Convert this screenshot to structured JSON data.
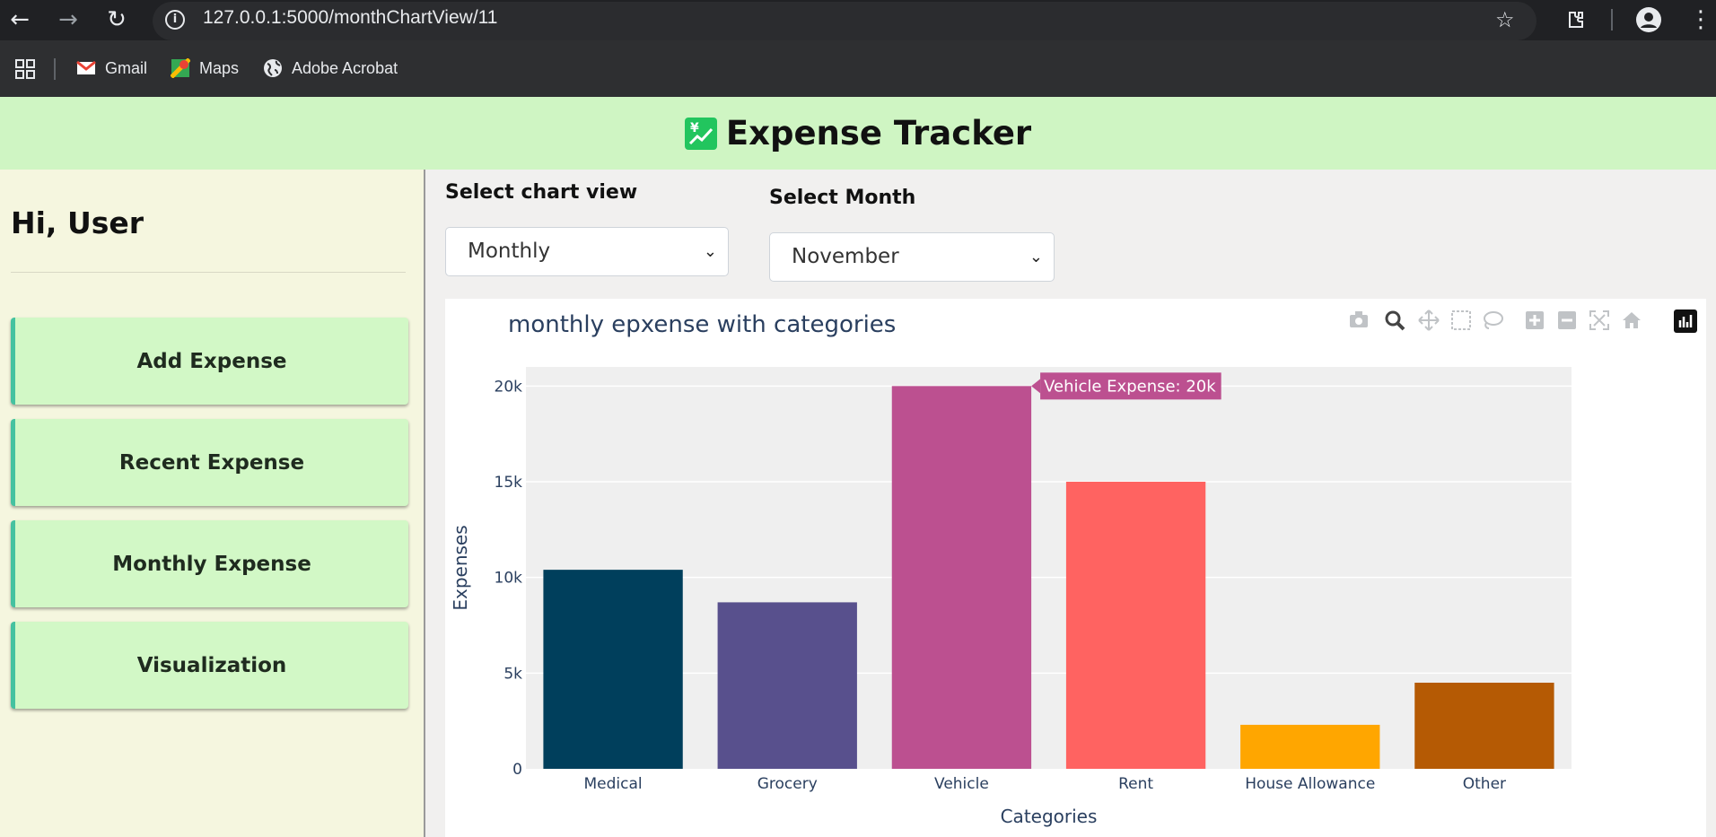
{
  "browser": {
    "url": "127.0.0.1:5000/monthChartView/11",
    "bookmarks": [
      "Gmail",
      "Maps",
      "Adobe Acrobat"
    ],
    "icons": [
      "back-arrow-icon",
      "forward-arrow-icon",
      "reload-icon",
      "info-icon",
      "star-icon",
      "extensions-icon",
      "profile-icon",
      "menu-dots-icon",
      "apps-grid-icon"
    ]
  },
  "app": {
    "title": "Expense Tracker",
    "greeting": "Hi, User",
    "nav": [
      "Add Expense",
      "Recent Expense",
      "Monthly Expense",
      "Visualization"
    ]
  },
  "controls": {
    "chart_view_label": "Select chart view",
    "chart_view_value": "Monthly",
    "month_label": "Select Month",
    "month_value": "November"
  },
  "tooltip": "Vehicle Expense: 20k",
  "colors": {
    "header_bg": "#cff5c3",
    "sidebar_bg": "#f5f6df",
    "button_bg": "#d2f8c6",
    "button_accent": "#45c2a0"
  },
  "chart_data": {
    "type": "bar",
    "title": "monthly epxense with categories",
    "xlabel": "Categories",
    "ylabel": "Expenses",
    "categories": [
      "Medical",
      "Grocery",
      "Vehicle",
      "Rent",
      "House Allowance",
      "Other"
    ],
    "values": [
      10400,
      8700,
      20000,
      15000,
      2300,
      4500
    ],
    "colors": [
      "#003f5c",
      "#58508d",
      "#bc5090",
      "#ff6361",
      "#ffa600",
      "#b55a04"
    ],
    "ylim": [
      0,
      21000
    ],
    "yticks": [
      0,
      5000,
      10000,
      15000,
      20000
    ],
    "ytick_labels": [
      "0",
      "5k",
      "10k",
      "15k",
      "20k"
    ],
    "grid": true
  }
}
